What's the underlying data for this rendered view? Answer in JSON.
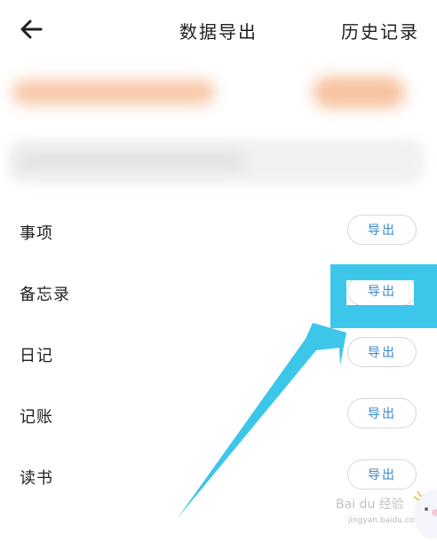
{
  "header": {
    "title": "数据导出",
    "history_label": "历史记录"
  },
  "rows": [
    {
      "label": "事项",
      "button": "导出"
    },
    {
      "label": "备忘录",
      "button": "导出"
    },
    {
      "label": "日记",
      "button": "导出"
    },
    {
      "label": "记账",
      "button": "导出"
    },
    {
      "label": "读书",
      "button": "导出"
    }
  ],
  "annotation": {
    "color": "#3cc6ea"
  },
  "watermark": {
    "brand": "Bai du 经验",
    "url": "jingyan.baidu.com"
  },
  "colors": {
    "accent": "#3a86c8",
    "button_border": "#d6d6d6"
  },
  "icons": {
    "back": "arrow-left-icon",
    "mascot": "mascot-icon"
  }
}
